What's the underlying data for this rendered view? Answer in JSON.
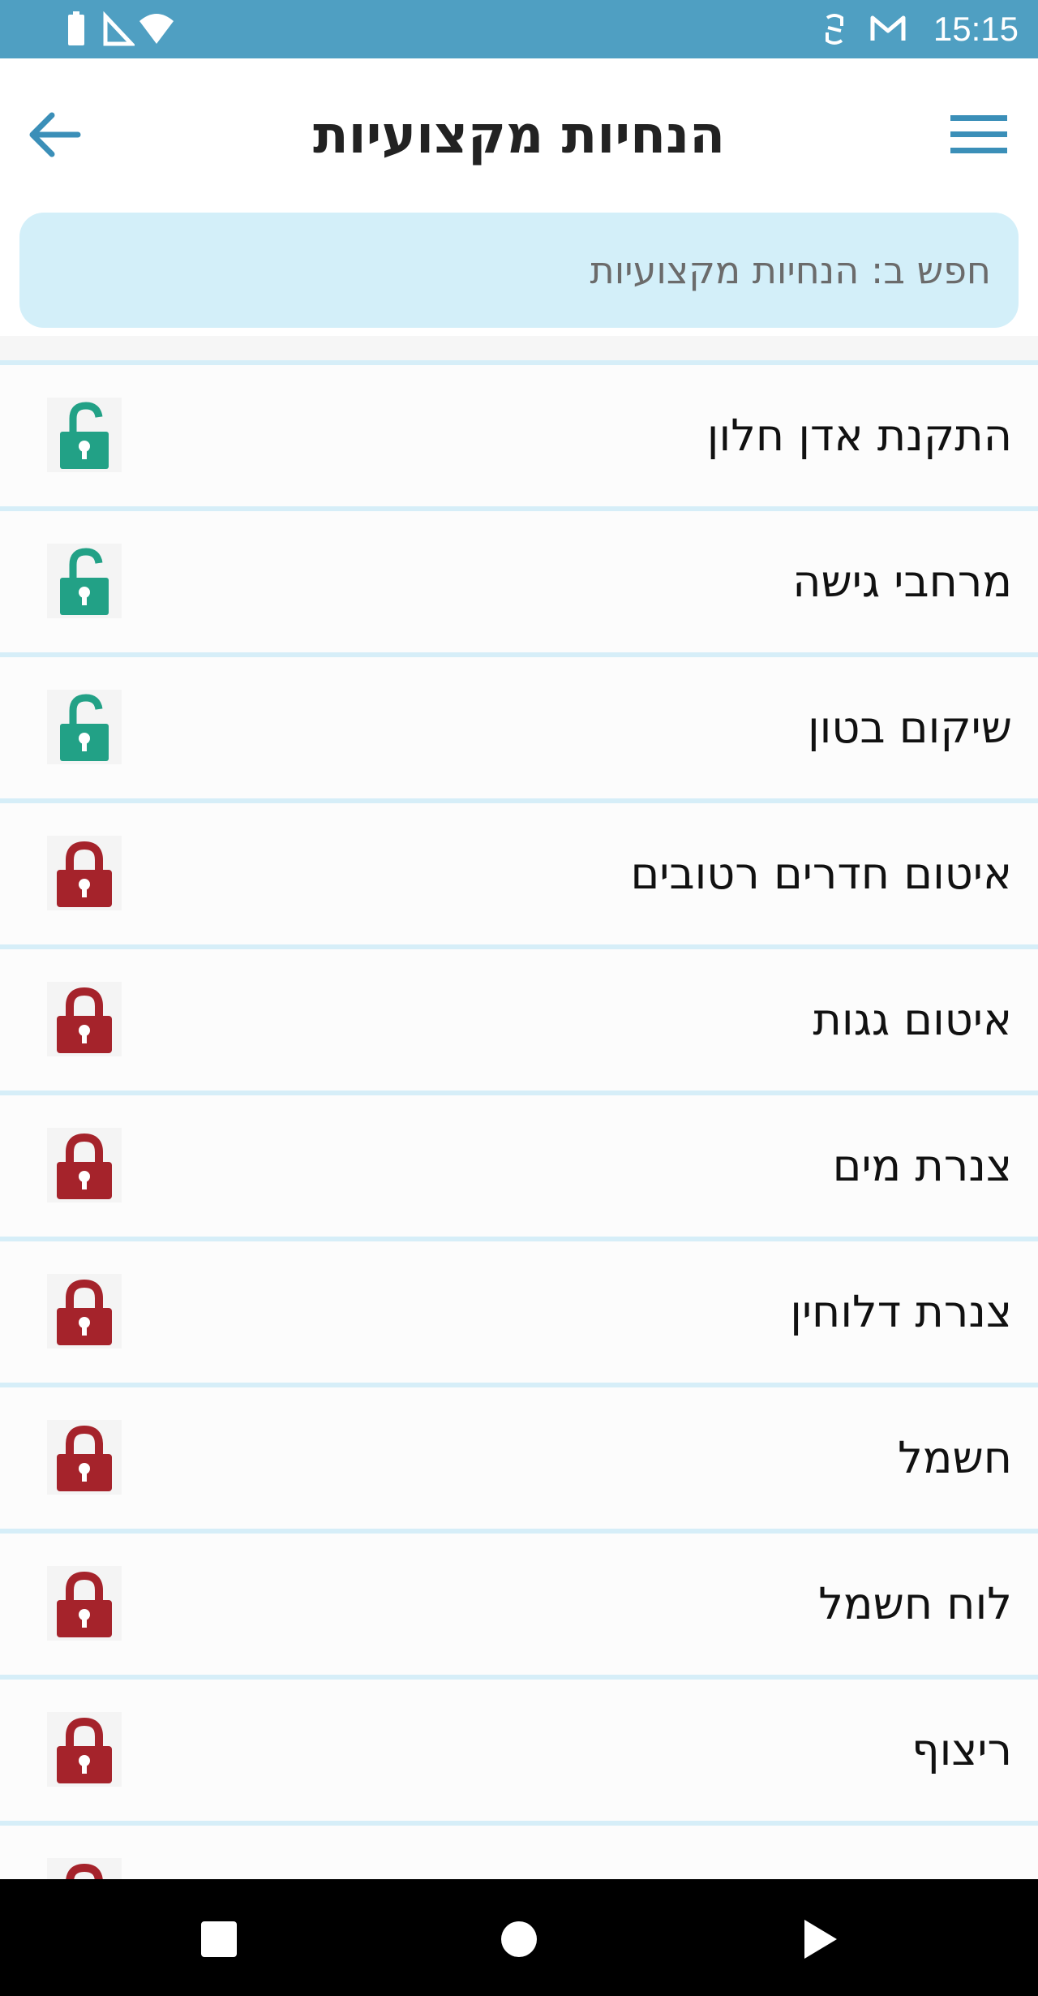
{
  "status_bar": {
    "time": "15:15",
    "left_icons": [
      "battery-icon",
      "signal-icon",
      "wifi-icon"
    ],
    "right_icons": [
      "sync-icon",
      "gmail-icon"
    ]
  },
  "header": {
    "title": "הנחיות מקצועיות",
    "back_icon": "arrow-left-icon",
    "menu_icon": "hamburger-menu-icon"
  },
  "search": {
    "placeholder": "חפש ב: הנחיות מקצועיות"
  },
  "list": {
    "items": [
      {
        "label": "התקנת אדן חלון",
        "locked": false
      },
      {
        "label": "מרחבי גישה",
        "locked": false
      },
      {
        "label": "שיקום בטון",
        "locked": false
      },
      {
        "label": "איטום חדרים רטובים",
        "locked": true
      },
      {
        "label": "איטום גגות",
        "locked": true
      },
      {
        "label": "צנרת מים",
        "locked": true
      },
      {
        "label": "צנרת דלוחין",
        "locked": true
      },
      {
        "label": "חשמל",
        "locked": true
      },
      {
        "label": "לוח חשמל",
        "locked": true
      },
      {
        "label": "ריצוף",
        "locked": true
      },
      {
        "label": "",
        "locked": true
      }
    ]
  },
  "colors": {
    "status_bar": "#4f9fc2",
    "accent": "#3b8fb8",
    "search_bg": "#d3eff9",
    "divider": "#d6eef8",
    "unlocked": "#22a186",
    "locked": "#a5232b"
  },
  "nav_bar": {
    "buttons": [
      "recent-apps-icon",
      "home-icon",
      "back-triangle-icon"
    ]
  }
}
